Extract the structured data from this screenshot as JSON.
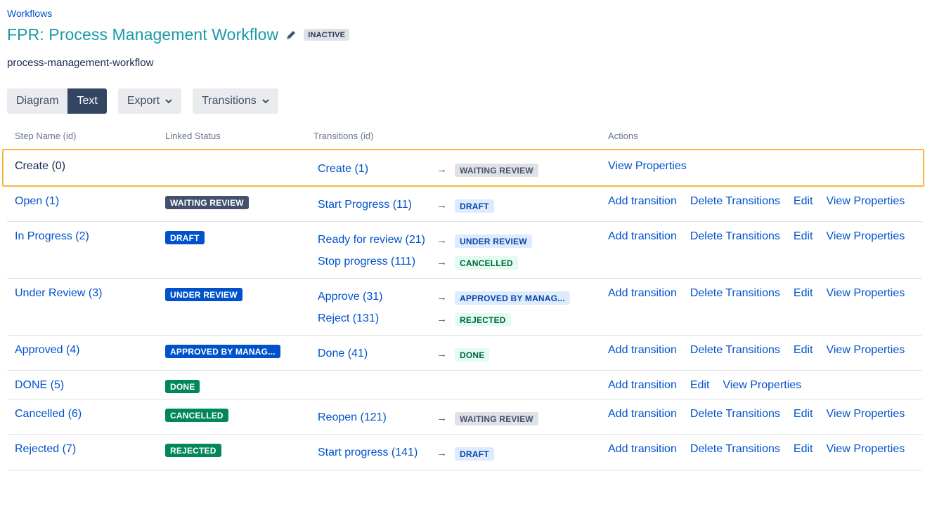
{
  "breadcrumb": "Workflows",
  "title": "FPR: Process Management Workflow",
  "status_badge": "INACTIVE",
  "workflow_key": "process-management-workflow",
  "toolbar": {
    "diagram": "Diagram",
    "text": "Text",
    "export": "Export",
    "transitions": "Transitions"
  },
  "columns": {
    "step": "Step Name (id)",
    "status": "Linked Status",
    "transitions": "Transitions (id)",
    "actions": "Actions"
  },
  "actions": {
    "add": "Add transition",
    "delete": "Delete Transitions",
    "edit": "Edit",
    "view": "View Properties"
  },
  "rows": [
    {
      "step": "Create (0)",
      "status": "",
      "transitions": [
        {
          "name": "Create (1)",
          "target": "WAITING REVIEW"
        }
      ]
    },
    {
      "step": "Open (1)",
      "status": "WAITING REVIEW",
      "transitions": [
        {
          "name": "Start Progress (11)",
          "target": "DRAFT"
        }
      ]
    },
    {
      "step": "In Progress (2)",
      "status": "DRAFT",
      "transitions": [
        {
          "name": "Ready for review (21)",
          "target": "UNDER REVIEW"
        },
        {
          "name": "Stop progress (111)",
          "target": "CANCELLED"
        }
      ]
    },
    {
      "step": "Under Review (3)",
      "status": "UNDER REVIEW",
      "transitions": [
        {
          "name": "Approve (31)",
          "target": "APPROVED BY MANAG..."
        },
        {
          "name": "Reject (131)",
          "target": "REJECTED"
        }
      ]
    },
    {
      "step": "Approved (4)",
      "status": "APPROVED BY MANAG...",
      "transitions": [
        {
          "name": "Done (41)",
          "target": "DONE"
        }
      ]
    },
    {
      "step": "DONE (5)",
      "status": "DONE",
      "transitions": []
    },
    {
      "step": "Cancelled (6)",
      "status": "CANCELLED",
      "transitions": [
        {
          "name": "Reopen (121)",
          "target": "WAITING REVIEW"
        }
      ]
    },
    {
      "step": "Rejected (7)",
      "status": "REJECTED",
      "transitions": [
        {
          "name": "Start progress (141)",
          "target": "DRAFT"
        }
      ]
    }
  ],
  "arrow_glyph": "→",
  "colors": {
    "title": "#1a9ba8",
    "link": "#0052cc",
    "highlight_border": "#f6b73c",
    "status_dark": "#42526e",
    "status_blue": "#0052cc",
    "status_green": "#00875a"
  }
}
